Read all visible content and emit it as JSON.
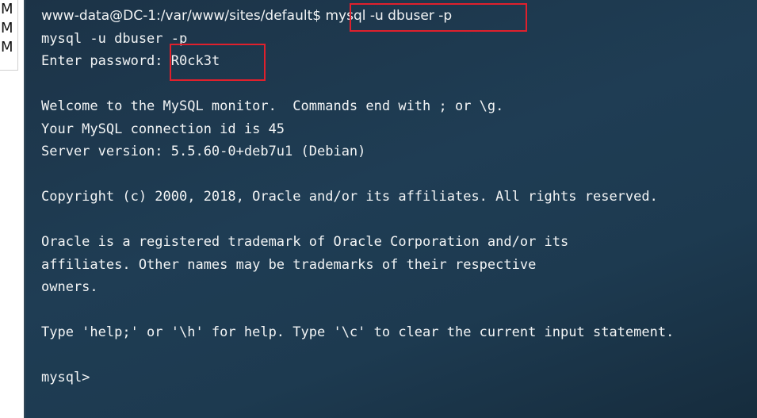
{
  "left_panel": {
    "letters": [
      "M",
      "M",
      "M"
    ]
  },
  "terminal": {
    "prompt": "www-data@DC-1:/var/www/sites/default$",
    "command": " mysql -u dbuser -p",
    "echo_line": "mysql -u dbuser -p",
    "password_label": "Enter password: ",
    "password_value": "R0ck3t",
    "welcome_line": "Welcome to the MySQL monitor.  Commands end with ; or \\g.",
    "connection_line": "Your MySQL connection id is 45",
    "version_line": "Server version: 5.5.60-0+deb7u1 (Debian)",
    "copyright_line": "Copyright (c) 2000, 2018, Oracle and/or its affiliates. All rights reserved.",
    "trademark_line_1": "Oracle is a registered trademark of Oracle Corporation and/or its",
    "trademark_line_2": "affiliates. Other names may be trademarks of their respective",
    "trademark_line_3": "owners.",
    "help_line": "Type 'help;' or '\\h' for help. Type '\\c' to clear the current input statement.",
    "mysql_prompt": "mysql>"
  },
  "colors": {
    "terminal_text": "#f2f4f5",
    "terminal_background": "#1f3d54",
    "highlight_border": "#e0202c"
  }
}
